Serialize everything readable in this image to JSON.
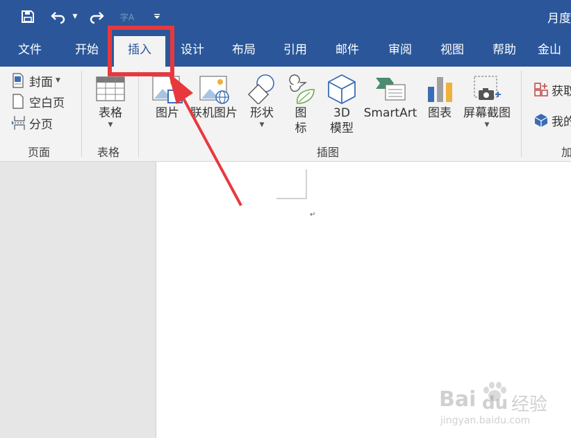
{
  "quick_access": {
    "save_icon": "save-icon",
    "undo_icon": "undo-icon",
    "redo_icon": "redo-icon",
    "format_painter_glyph": "字A",
    "customize_icon": "customize-qat-icon"
  },
  "document_title": "月度",
  "tabs": [
    {
      "label": "文件"
    },
    {
      "label": "开始"
    },
    {
      "label": "插入"
    },
    {
      "label": "设计"
    },
    {
      "label": "布局"
    },
    {
      "label": "引用"
    },
    {
      "label": "邮件"
    },
    {
      "label": "审阅"
    },
    {
      "label": "视图"
    },
    {
      "label": "帮助"
    },
    {
      "label": "金山"
    }
  ],
  "active_tab": "插入",
  "ribbon": {
    "pages": {
      "label": "页面",
      "cover": "封面",
      "blank_page": "空白页",
      "page_break": "分页"
    },
    "tables": {
      "label": "表格",
      "table": "表格"
    },
    "illustrations": {
      "label": "插图",
      "picture": "图片",
      "online_pictures": "联机图片",
      "shapes": "形状",
      "icons_line1": "图",
      "icons_line2": "标",
      "model_line1": "3D",
      "model_line2": "模型",
      "smartart": "SmartArt",
      "chart": "图表",
      "screenshot": "屏幕截图"
    },
    "addins": {
      "label": "加",
      "get": "获取",
      "my": "我的"
    }
  },
  "document": {
    "paragraph_mark": "↵"
  },
  "watermark": {
    "brand": "Bai",
    "brand2": "du",
    "brand_cn": "经验",
    "url": "jingyan.baidu.com"
  },
  "colors": {
    "accent": "#2b579a",
    "highlight": "#e8383d"
  }
}
